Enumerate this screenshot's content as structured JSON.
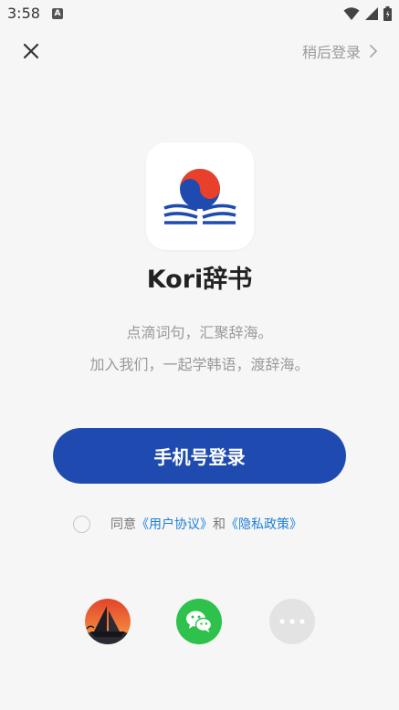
{
  "status_bar": {
    "time": "3:58",
    "app_icon": "android-a-icon",
    "app_icon_glyph": "A",
    "icons": [
      "wifi-icon",
      "signal-icon",
      "battery-icon"
    ]
  },
  "header": {
    "close_icon": "close-icon",
    "skip_label": "稍后登录",
    "skip_icon": "chevron-right-icon"
  },
  "brand": {
    "logo_icon": "kori-logo-icon",
    "app_name": "Kori辞书",
    "slogan_line1": "点滴词句，汇聚辞海。",
    "slogan_line2": "加入我们，一起学韩语，渡辞海。",
    "colors": {
      "taeguk_red": "#e8402b",
      "taeguk_blue": "#1f4bb1"
    }
  },
  "login": {
    "phone_login_label": "手机号登录",
    "button_color": "#1f4bb1"
  },
  "agreement": {
    "checked": false,
    "prefix": "同意",
    "user_agreement": "《用户协议》",
    "conjunction": "和",
    "privacy_policy": "《隐私政策》",
    "link_color": "#1e7fd8"
  },
  "social_login": {
    "items": [
      {
        "name": "boat-sunset-icon"
      },
      {
        "name": "wechat-icon",
        "color": "#2ec24c"
      },
      {
        "name": "more-icon"
      }
    ]
  }
}
